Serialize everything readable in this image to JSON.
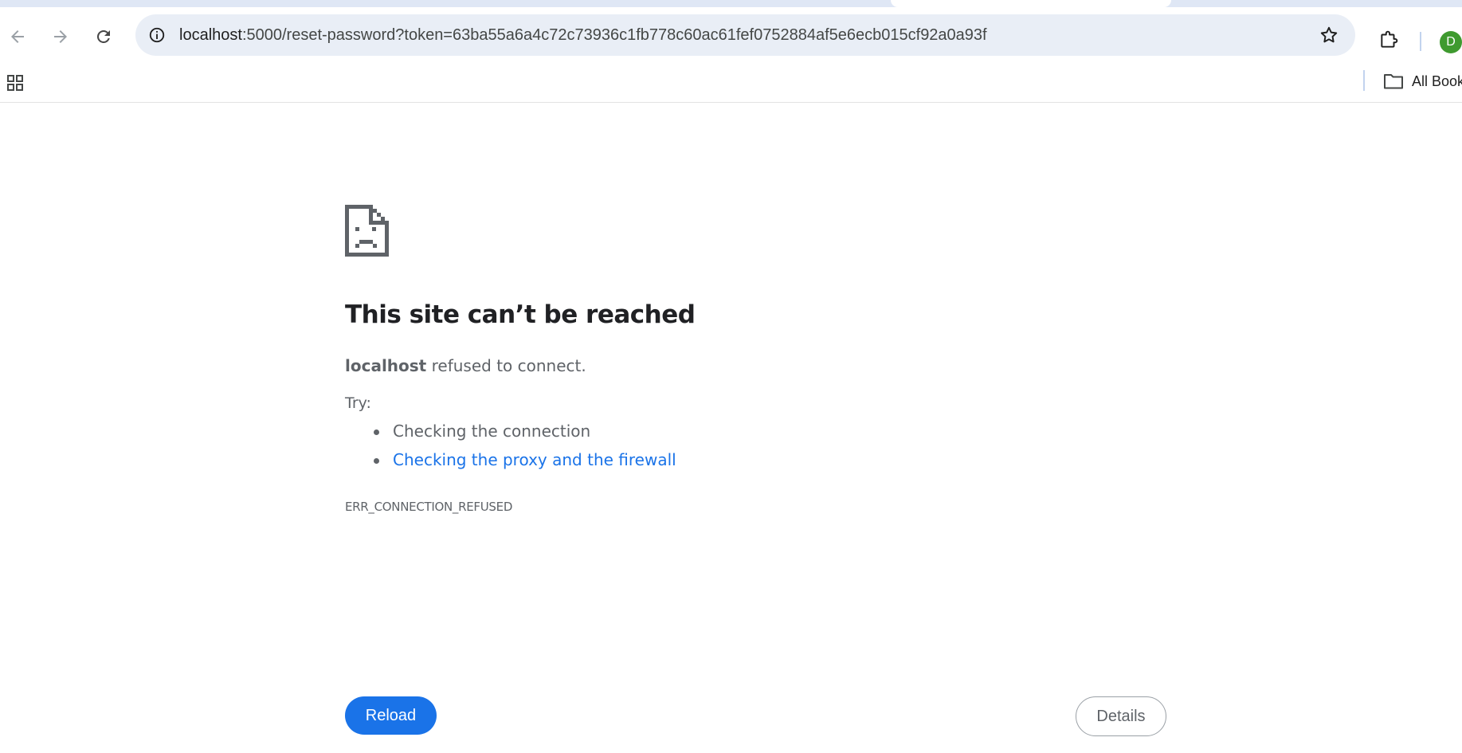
{
  "browser": {
    "url_host": "localhost",
    "url_rest": ":5000/reset-password?token=63ba55a6a4c72c73936c1fb778c60ac61fef0752884af5e6ecb015cf92a0a93f",
    "profile_initial": "D",
    "profile_color": "#3f9a2f",
    "bookmarks_label": "All Bookmarks",
    "icons": [
      "back-arrow-icon",
      "forward-arrow-icon",
      "reload-icon",
      "site-info-icon",
      "bookmark-star-icon",
      "extensions-puzzle-icon",
      "apps-grid-icon",
      "folder-icon"
    ]
  },
  "error_page": {
    "icon": "sad-document-icon",
    "title": "This site can’t be reached",
    "host": "localhost",
    "message": " refused to connect.",
    "try_label": "Try:",
    "suggestions": [
      "Checking the connection",
      "Checking the proxy and the firewall"
    ],
    "error_code": "ERR_CONNECTION_REFUSED",
    "reload_label": "Reload",
    "details_label": "Details",
    "link_color": "#1a73e8"
  }
}
